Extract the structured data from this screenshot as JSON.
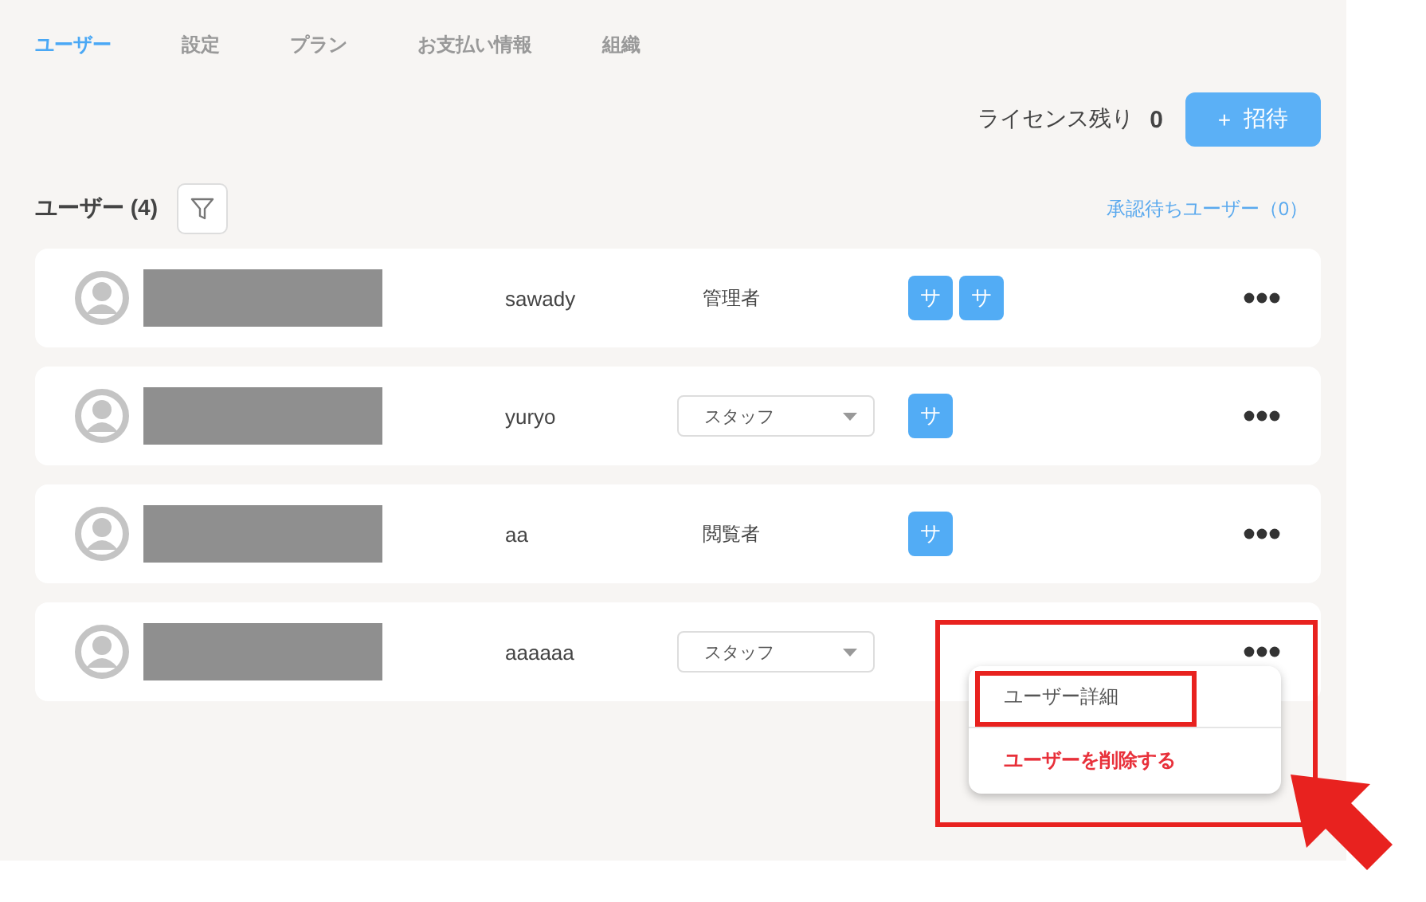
{
  "tabs": [
    {
      "label": "ユーザー",
      "selected": true
    },
    {
      "label": "設定",
      "selected": false
    },
    {
      "label": "プラン",
      "selected": false
    },
    {
      "label": "お支払い情報",
      "selected": false
    },
    {
      "label": "組織",
      "selected": false
    }
  ],
  "license": {
    "label": "ライセンス残り",
    "count": "0"
  },
  "invite_button": {
    "icon": "+",
    "label": "招待"
  },
  "users_header": {
    "title": "ユーザー (4)",
    "pending_link": "承認待ちユーザー（0）"
  },
  "rows": [
    {
      "username": "sawady",
      "role": {
        "kind": "text",
        "value": "管理者"
      },
      "badges": [
        "サ",
        "サ"
      ],
      "menu_open": false
    },
    {
      "username": "yuryo",
      "role": {
        "kind": "select",
        "value": "スタッフ"
      },
      "badges": [
        "サ"
      ],
      "menu_open": false
    },
    {
      "username": "aa",
      "role": {
        "kind": "text",
        "value": "閲覧者"
      },
      "badges": [
        "サ"
      ],
      "menu_open": false
    },
    {
      "username": "aaaaaa",
      "role": {
        "kind": "select",
        "value": "スタッフ"
      },
      "badges": [],
      "menu_open": true
    }
  ],
  "menu": {
    "items": [
      {
        "label": "ユーザー詳細",
        "kind": "normal"
      },
      {
        "label": "ユーザーを削除する",
        "kind": "danger"
      }
    ]
  }
}
